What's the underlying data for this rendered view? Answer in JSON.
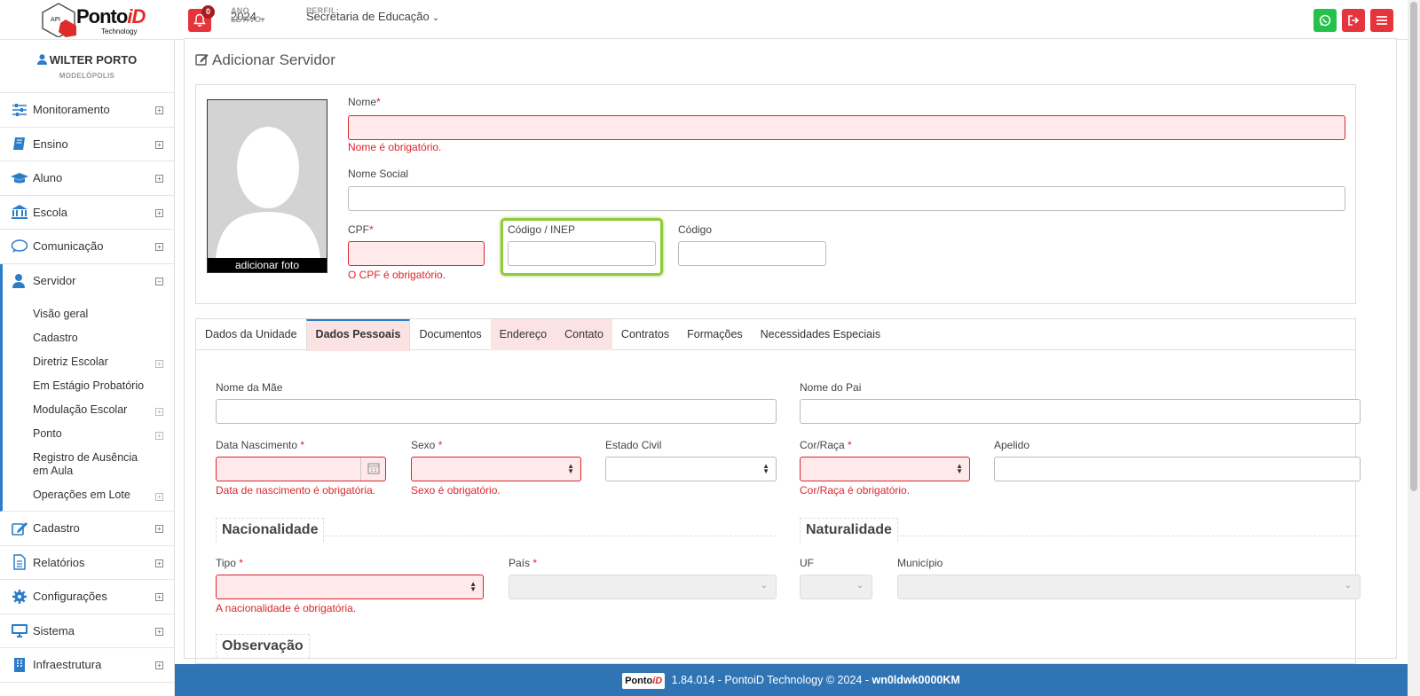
{
  "header": {
    "logo_text": "PontoiD",
    "logo_sub": "Technology",
    "logo_badge": "API",
    "notifications_count": "0",
    "ano_letivo_label": "ANO LETIVO:",
    "ano_letivo_value": "2024",
    "perfil_label": "PERFIL:",
    "perfil_value": "Secretaria de Educação",
    "colors": {
      "whatsapp": "#25c24b",
      "red": "#e5343b"
    }
  },
  "sidebar": {
    "user_name": "WILTER PORTO",
    "user_city": "MODELÓPOLIS",
    "items_top": [
      {
        "label": "Monitoramento",
        "icon": "sliders-icon"
      },
      {
        "label": "Ensino",
        "icon": "book-icon"
      },
      {
        "label": "Aluno",
        "icon": "graduation-cap-icon"
      },
      {
        "label": "Escola",
        "icon": "bank-icon"
      },
      {
        "label": "Comunicação",
        "icon": "chat-icon"
      }
    ],
    "active_item": {
      "label": "Servidor",
      "icon": "user-icon"
    },
    "sub_items": [
      {
        "label": "Visão geral"
      },
      {
        "label": "Cadastro"
      },
      {
        "label": "Diretriz Escolar"
      },
      {
        "label": "Em Estágio Probatório"
      },
      {
        "label": "Modulação Escolar"
      },
      {
        "label": "Ponto"
      },
      {
        "label": "Registro de Ausência em Aula"
      },
      {
        "label": "Operações em Lote"
      }
    ],
    "items_bottom": [
      {
        "label": "Cadastro",
        "icon": "edit-icon"
      },
      {
        "label": "Relatórios",
        "icon": "file-icon"
      },
      {
        "label": "Configurações",
        "icon": "gear-icon"
      },
      {
        "label": "Sistema",
        "icon": "monitor-icon"
      },
      {
        "label": "Infraestrutura",
        "icon": "building-icon"
      }
    ]
  },
  "main": {
    "title": "Adicionar Servidor",
    "photo_caption": "adicionar foto",
    "nome_label": "Nome",
    "nome_error": "Nome é obrigatório.",
    "nome_social_label": "Nome Social",
    "cpf_label": "CPF",
    "cpf_error": "O CPF é obrigatório.",
    "inep_label": "Código / INEP",
    "codigo_label": "Código",
    "tabs": [
      {
        "label": "Dados da Unidade"
      },
      {
        "label": "Dados Pessoais"
      },
      {
        "label": "Documentos"
      },
      {
        "label": "Endereço"
      },
      {
        "label": "Contato"
      },
      {
        "label": "Contratos"
      },
      {
        "label": "Formações"
      },
      {
        "label": "Necessidades Especiais"
      }
    ],
    "form": {
      "mae_label": "Nome da Mãe",
      "pai_label": "Nome do Pai",
      "nascimento_label": "Data Nascimento",
      "nascimento_error": "Data de nascimento é obrigatória.",
      "sexo_label": "Sexo",
      "sexo_error": "Sexo é obrigatório.",
      "civil_label": "Estado Civil",
      "raca_label": "Cor/Raça",
      "raca_error": "Cor/Raça é obrigatório.",
      "apelido_label": "Apelido",
      "nacionalidade_title": "Nacionalidade",
      "naturalidade_title": "Naturalidade",
      "tipo_label": "Tipo",
      "tipo_error": "A nacionalidade é obrigatória.",
      "pais_label": "País",
      "uf_label": "UF",
      "municipio_label": "Município",
      "observacao_title": "Observação"
    }
  },
  "footer": {
    "logo_text": "PontoiD",
    "version_text": "1.84.014 - PontoiD Technology © 2024 -",
    "host": "wn0ldwk0000KM"
  }
}
